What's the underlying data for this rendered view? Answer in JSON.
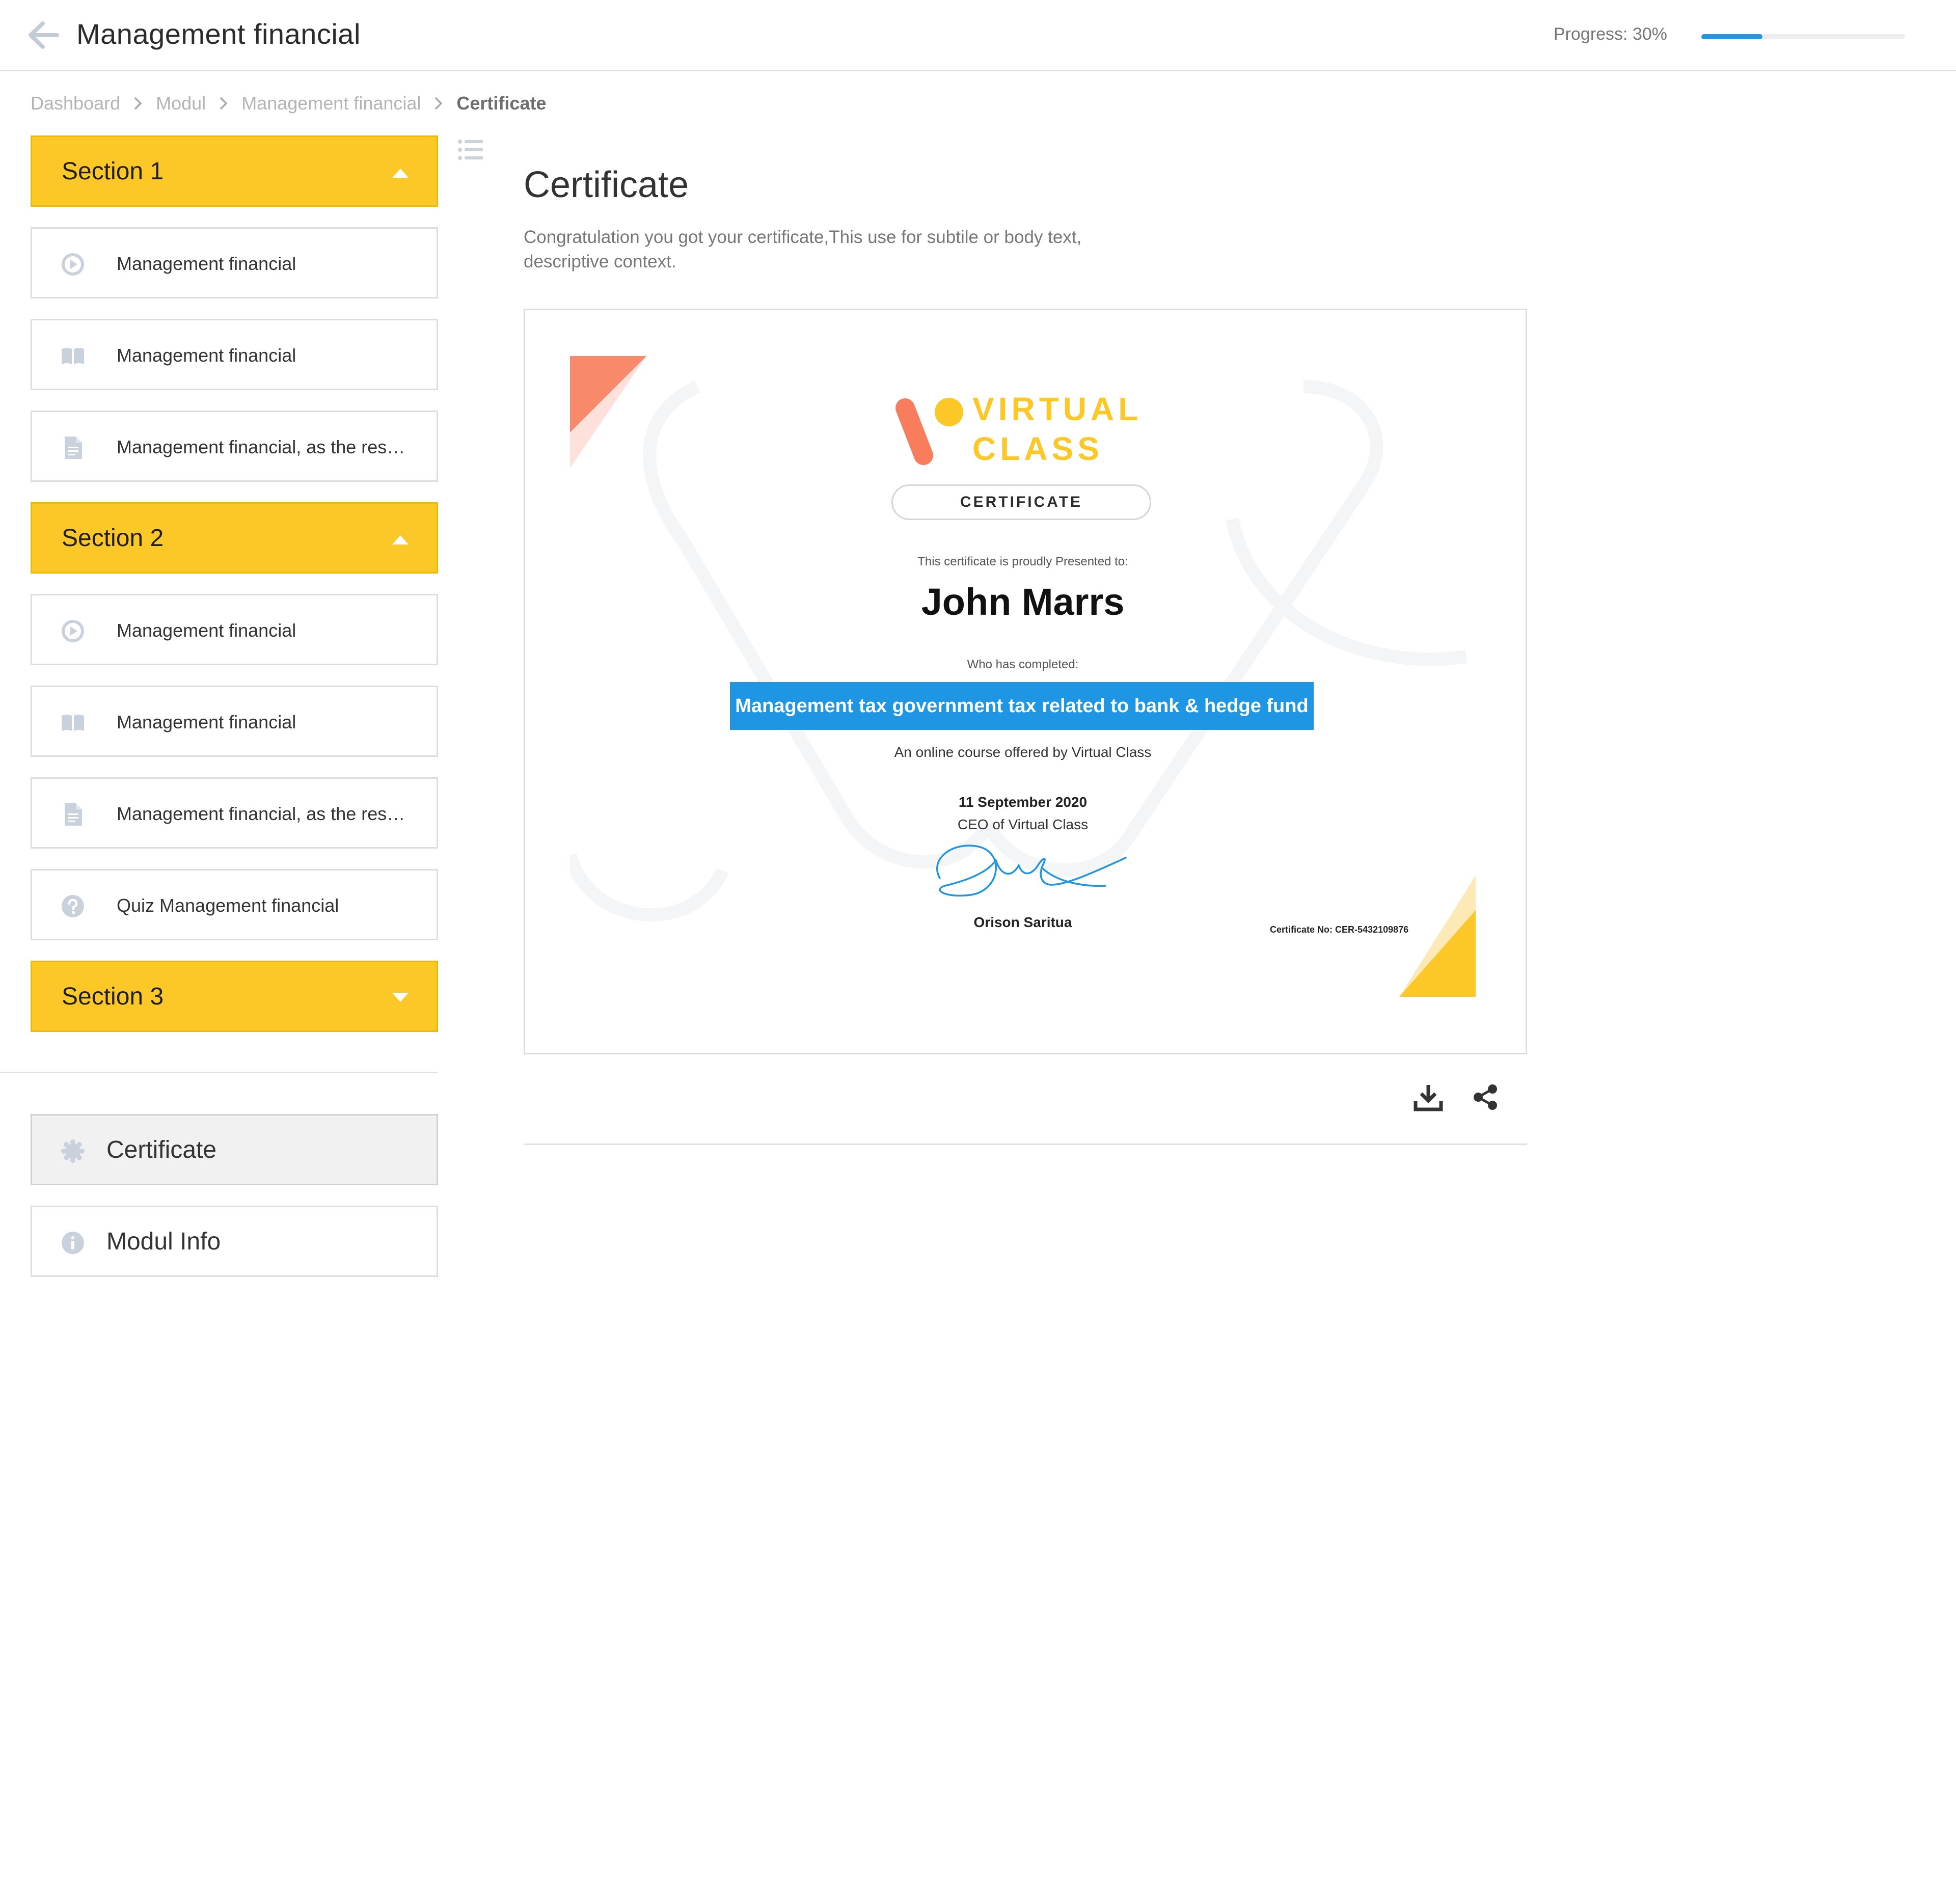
{
  "header": {
    "title": "Management financial",
    "progress_label": "Progress: 30%",
    "progress_value": 0.3,
    "progress_color": "#2196e6"
  },
  "breadcrumb": [
    "Dashboard",
    "Modul",
    "Management financial",
    "Certificate"
  ],
  "sidebar": {
    "sections": [
      {
        "title": "Section 1",
        "state": "expanded",
        "items": [
          {
            "icon": "play-circle-icon",
            "label": "Management financial"
          },
          {
            "icon": "book-icon",
            "label": "Management financial"
          },
          {
            "icon": "document-icon",
            "label": "Management financial, as the res…"
          }
        ]
      },
      {
        "title": "Section 2",
        "state": "expanded",
        "items": [
          {
            "icon": "play-circle-icon",
            "label": "Management financial"
          },
          {
            "icon": "book-icon",
            "label": "Management financial"
          },
          {
            "icon": "document-icon",
            "label": "Management financial, as the res…"
          },
          {
            "icon": "question-circle-icon",
            "label": "Quiz Management financial"
          }
        ]
      },
      {
        "title": "Section 3",
        "state": "collapsed",
        "items": []
      }
    ],
    "bottom_items": [
      {
        "icon": "badge-icon",
        "label": "Certificate",
        "active": true
      },
      {
        "icon": "info-icon",
        "label": "Modul Info",
        "active": false
      }
    ],
    "section_color": "#fcc827"
  },
  "main": {
    "title": "Certificate",
    "description": "Congratulation you got your certificate,This use for subtile or body text, descriptive context.",
    "certificate": {
      "brand_line1": "VIRTUAL",
      "brand_line2": "CLASS",
      "badge": "CERTIFICATE",
      "presented_to": "This certificate is proudly Presented to:",
      "recipient": "John Marrs",
      "who_completed": "Who has completed:",
      "course": "Management tax government tax related to bank & hedge fund",
      "offered_by": "An online course offered by Virtual Class",
      "date": "11 September 2020",
      "signer_title": "CEO of Virtual Class",
      "signer_name": "Orison Saritua",
      "certificate_no": "Certificate No: CER-5432109876",
      "accent_color": "#1e96e4",
      "brand_color": "#fcc827"
    },
    "actions": [
      {
        "icon": "download-icon"
      },
      {
        "icon": "share-icon"
      }
    ]
  }
}
